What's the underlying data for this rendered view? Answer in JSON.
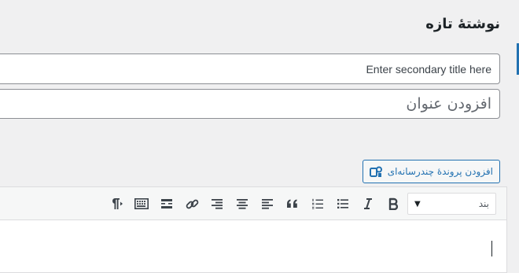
{
  "page": {
    "title": "نوشتهٔ تازه"
  },
  "fields": {
    "secondary_title_placeholder": "Enter secondary title here",
    "title_placeholder": "افزودن عنوان"
  },
  "media": {
    "add_media_label": "افزودن پروندهٔ چندرسانه‌ای"
  },
  "toolbar": {
    "format_select_value": "بند",
    "format_select_arrow": "▼",
    "buttons": [
      {
        "name": "paragraph-mark-icon"
      },
      {
        "name": "toolbar-toggle-icon"
      },
      {
        "name": "read-more-icon"
      },
      {
        "name": "link-icon"
      },
      {
        "name": "align-right-icon"
      },
      {
        "name": "align-center-icon"
      },
      {
        "name": "align-left-icon"
      },
      {
        "name": "blockquote-icon"
      },
      {
        "name": "numbered-list-icon"
      },
      {
        "name": "bullet-list-icon"
      },
      {
        "name": "italic-icon"
      },
      {
        "name": "bold-icon"
      }
    ]
  },
  "colors": {
    "background": "#f0f0f1",
    "accent": "#2271b1",
    "icon": "#3c434a"
  }
}
